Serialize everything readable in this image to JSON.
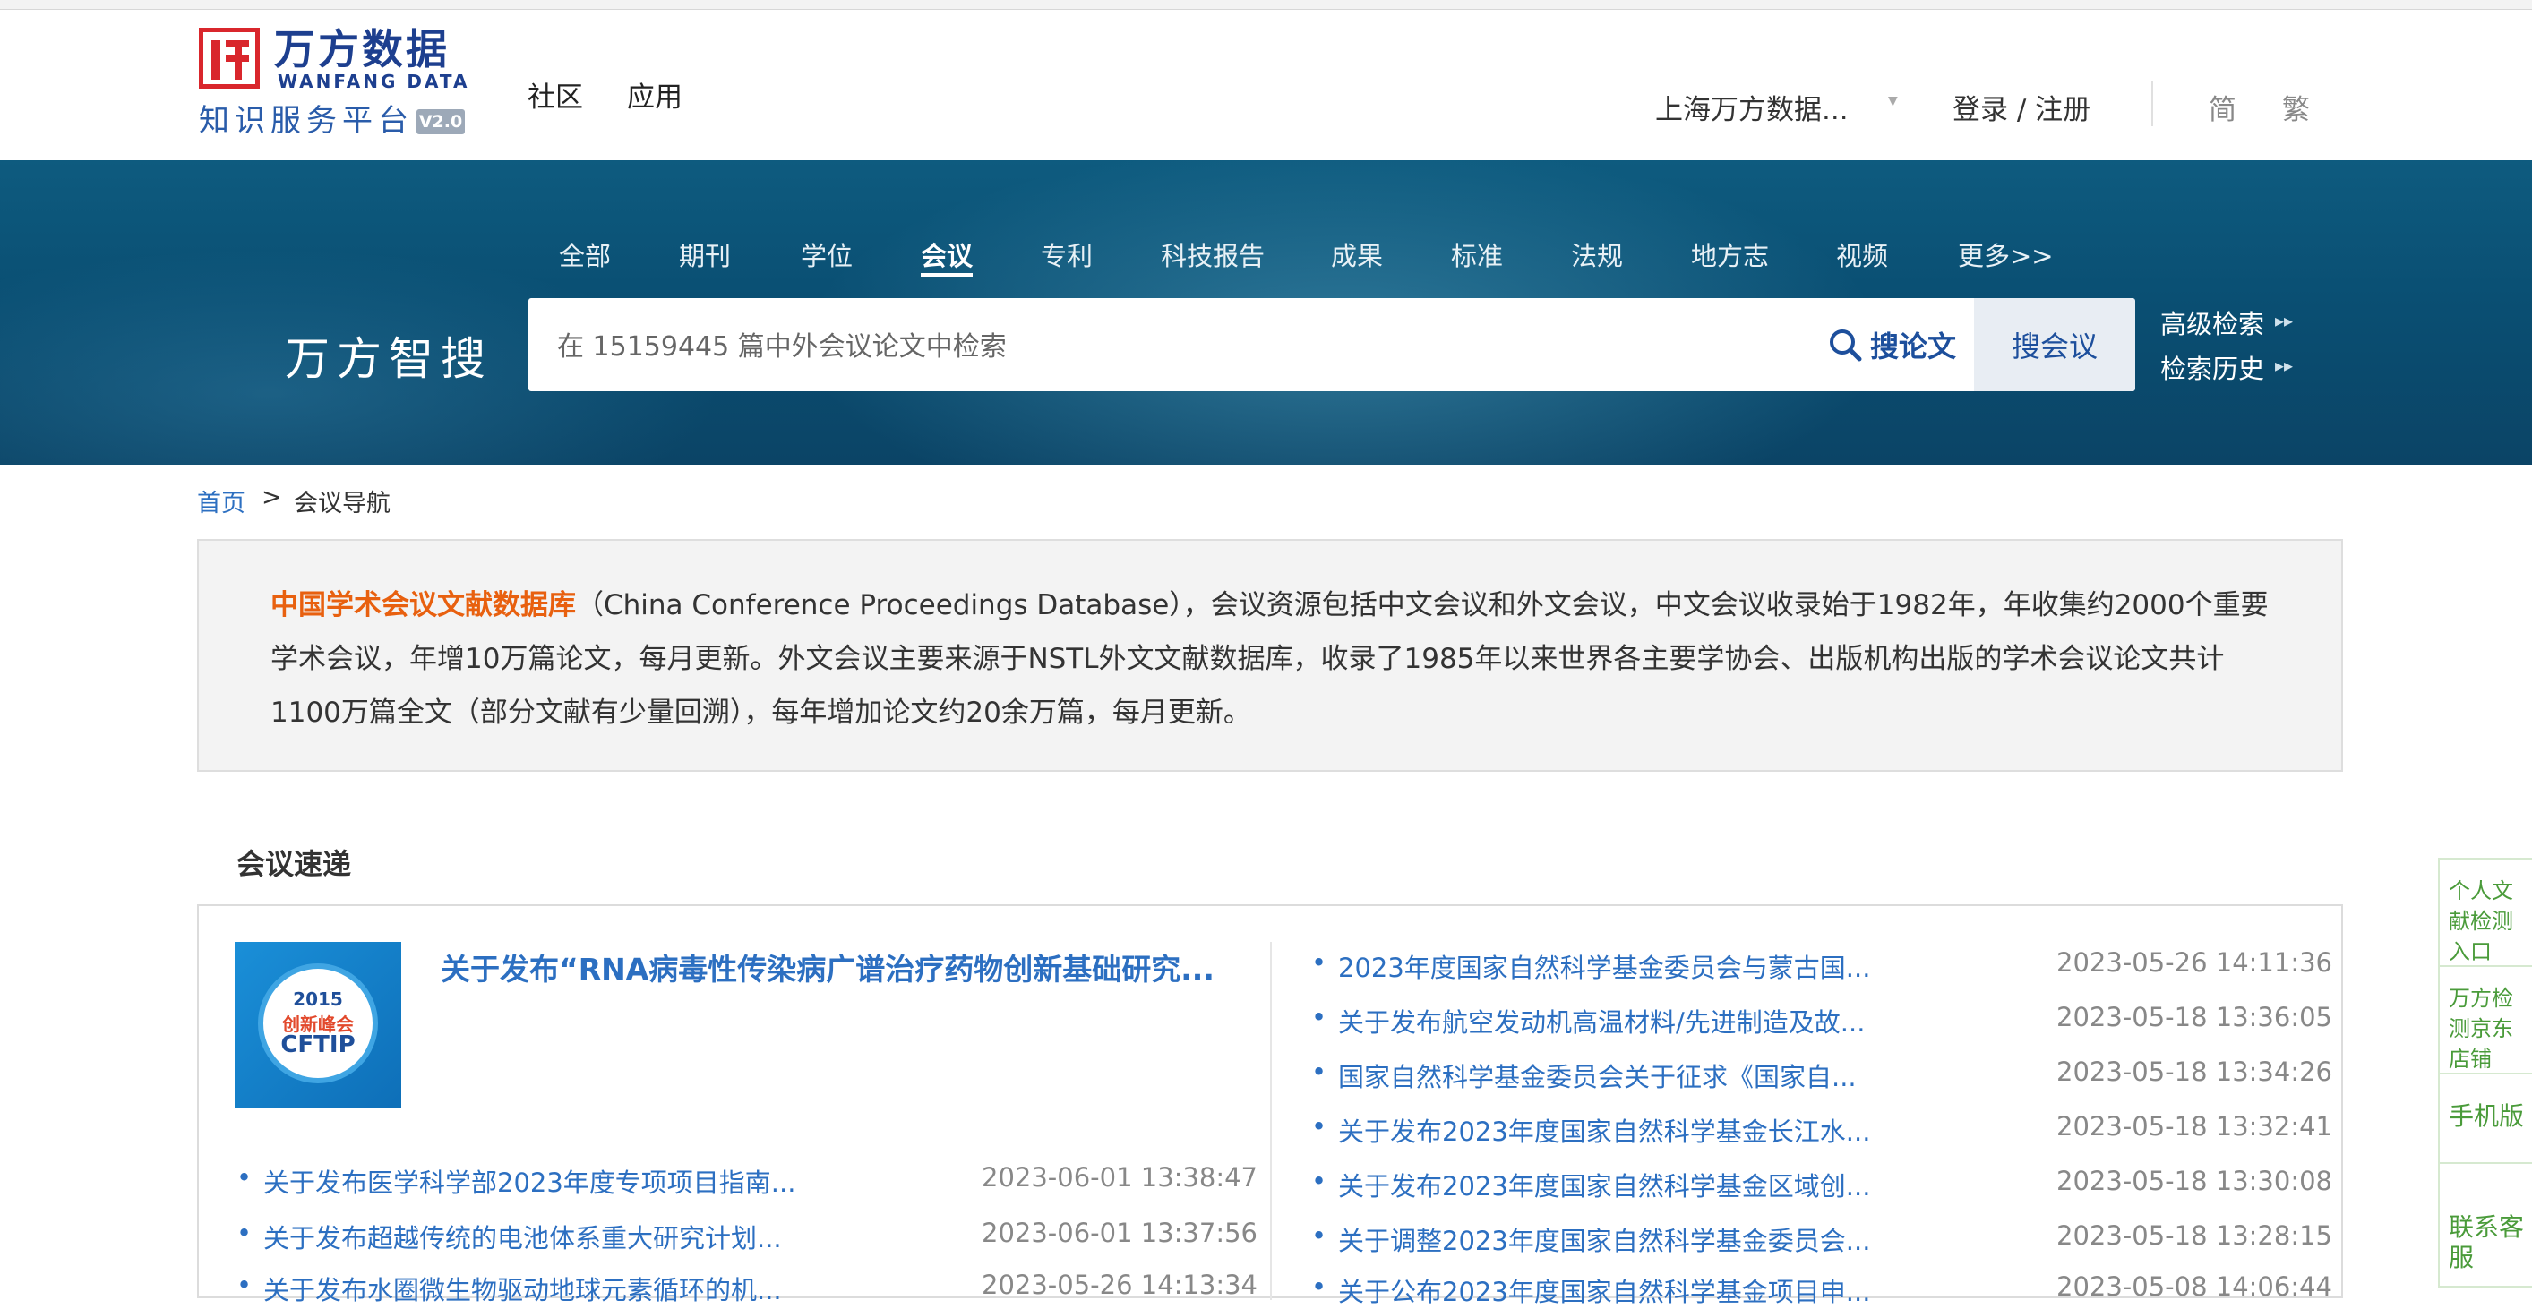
{
  "header": {
    "logo_cn": "万方数据",
    "logo_en": "WANFANG DATA",
    "logo_sub": "知识服务平台",
    "logo_version": "V2.0",
    "nav": [
      "社区",
      "应用"
    ],
    "org": "上海万方数据...",
    "login": "登录 / 注册",
    "lang_simplified": "简",
    "lang_traditional": "繁"
  },
  "search": {
    "categories": [
      "全部",
      "期刊",
      "学位",
      "会议",
      "专利",
      "科技报告",
      "成果",
      "标准",
      "法规",
      "地方志",
      "视频",
      "更多>>"
    ],
    "active_category": "会议",
    "brand": "万方智搜",
    "placeholder": "在 15159445 篇中外会议论文中检索",
    "btn_paper": "搜论文",
    "btn_meeting": "搜会议",
    "advanced": "高级检索",
    "history": "检索历史"
  },
  "breadcrumb": {
    "home": "首页",
    "sep": ">",
    "current": "会议导航"
  },
  "intro": {
    "highlight": "中国学术会议文献数据库",
    "text": "（China Conference Proceedings Database），会议资源包括中文会议和外文会议，中文会议收录始于1982年，年收集约2000个重要学术会议，年增10万篇论文，每月更新。外文会议主要来源于NSTL外文文献数据库，收录了1985年以来世界各主要学协会、出版机构出版的学术会议论文共计1100万篇全文（部分文献有少量回溯），每年增加论文约20余万篇，每月更新。"
  },
  "news_section": {
    "title": "会议速递",
    "thumb": {
      "year": "2015",
      "line2": "创新峰会",
      "line3": "CFTIP"
    },
    "featured": "关于发布“RNA病毒性传染病广谱治疗药物创新基础研究...",
    "left_list": [
      {
        "title": "关于发布医学科学部2023年度专项项目指南...",
        "date": "2023-06-01 13:38:47"
      },
      {
        "title": "关于发布超越传统的电池体系重大研究计划...",
        "date": "2023-06-01 13:37:56"
      },
      {
        "title": "关于发布水圈微生物驱动地球元素循环的机...",
        "date": "2023-05-26 14:13:34"
      }
    ],
    "right_list": [
      {
        "title": "2023年度国家自然科学基金委员会与蒙古国...",
        "date": "2023-05-26 14:11:36"
      },
      {
        "title": "关于发布航空发动机高温材料/先进制造及故...",
        "date": "2023-05-18 13:36:05"
      },
      {
        "title": "国家自然科学基金委员会关于征求《国家自...",
        "date": "2023-05-18 13:34:26"
      },
      {
        "title": "关于发布2023年度国家自然科学基金长江水...",
        "date": "2023-05-18 13:32:41"
      },
      {
        "title": "关于发布2023年度国家自然科学基金区域创...",
        "date": "2023-05-18 13:30:08"
      },
      {
        "title": "关于调整2023年度国家自然科学基金委员会...",
        "date": "2023-05-18 13:28:15"
      },
      {
        "title": "关于公布2023年度国家自然科学基金项目申...",
        "date": "2023-05-08 14:06:44"
      }
    ]
  },
  "float_bar": [
    "个人文献检测入口",
    "万方检测京东店铺",
    "手机版",
    "联系客服"
  ],
  "colors": {
    "accent": "#2c6fc1",
    "brand": "#1d3f8f",
    "highlight": "#e8600f",
    "float": "#4a9b3a"
  }
}
